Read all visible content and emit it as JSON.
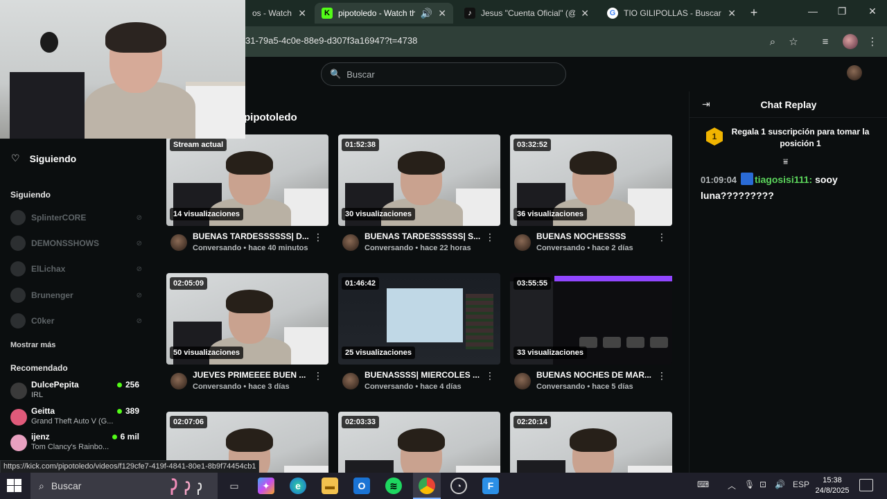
{
  "tabs": [
    {
      "title": "os - Watch C",
      "fav_color": "#53fc18",
      "fav_glyph": ""
    },
    {
      "title": "pipotoledo - Watch the",
      "fav_color": "#53fc18",
      "fav_glyph": "K"
    },
    {
      "title": "Jesus \"Cuenta Oficial\" (@jes",
      "fav_color": "#111111",
      "fav_glyph": "♪"
    },
    {
      "title": "TIO GILIPOLLAS - Buscar con",
      "fav_color": "#ffffff",
      "fav_glyph": "G"
    }
  ],
  "address": {
    "url": "31-79a5-4c0e-88e9-d307f3a16947?t=4738"
  },
  "search": {
    "placeholder": "Buscar"
  },
  "sidebar": {
    "following_label": "Siguiendo",
    "section_following": "Siguiendo",
    "followed": [
      {
        "name": "SplinterCORE"
      },
      {
        "name": "DEMONSSHOWS"
      },
      {
        "name": "ElLichax"
      },
      {
        "name": "Brunenger"
      },
      {
        "name": "C0ker"
      }
    ],
    "show_more": "Mostrar más",
    "section_recommended": "Recomendado",
    "recommended": [
      {
        "name": "DulcePepita",
        "category": "IRL",
        "viewers": "256"
      },
      {
        "name": "Geitta",
        "category": "Grand Theft Auto V (G...",
        "viewers": "389"
      },
      {
        "name": "ijenz",
        "category": "Tom Clancy's Rainbo...",
        "viewers": "6 mil"
      }
    ]
  },
  "channel": {
    "name": "pipotoledo"
  },
  "videos": [
    {
      "duration": "Stream actual",
      "views": "14 visualizaciones",
      "title": "BUENAS TARDESSSSSS| D...",
      "sub": "Conversando • hace 40 minutos",
      "thumb": "room"
    },
    {
      "duration": "01:52:38",
      "views": "30 visualizaciones",
      "title": "BUENAS TARDESSSSSS| S...",
      "sub": "Conversando • hace 22 horas",
      "thumb": "room"
    },
    {
      "duration": "03:32:52",
      "views": "36 visualizaciones",
      "title": "BUENAS NOCHESSSS",
      "sub": "Conversando • hace 2 días",
      "thumb": "room"
    },
    {
      "duration": "02:05:09",
      "views": "50 visualizaciones",
      "title": "JUEVES PRIMEEEE BUEN ...",
      "sub": "Conversando • hace 3 días",
      "thumb": "room"
    },
    {
      "duration": "01:46:42",
      "views": "25 visualizaciones",
      "title": "BUENASSSS| MIERCOLES ...",
      "sub": "Conversando • hace 4 días",
      "thumb": "screen"
    },
    {
      "duration": "03:55:55",
      "views": "33 visualizaciones",
      "title": "BUENAS NOCHES DE MAR...",
      "sub": "Conversando • hace 5 días",
      "thumb": "discord"
    },
    {
      "duration": "02:07:06",
      "views": "",
      "title": "",
      "sub": "",
      "thumb": "room"
    },
    {
      "duration": "02:03:33",
      "views": "",
      "title": "",
      "sub": "",
      "thumb": "room"
    },
    {
      "duration": "02:20:14",
      "views": "",
      "title": "",
      "sub": "",
      "thumb": "room"
    }
  ],
  "chat": {
    "title": "Chat Replay",
    "pinned_rank": "1",
    "pinned_text": "Regala 1 suscripción para tomar la posición 1",
    "messages": [
      {
        "time": "01:09:04",
        "user": "tiagosisi111",
        "text": "sooy luna?????????"
      }
    ]
  },
  "status_url": "https://kick.com/pipotoledo/videos/f129cfe7-419f-4841-80e1-8b9f74454cb1",
  "taskbar": {
    "search_placeholder": "Buscar",
    "language": "ESP",
    "time": "15:38",
    "date": "24/8/2025"
  },
  "colors": {
    "accent": "#53fc18",
    "chat_user": "#5cd65c",
    "rank_badge": "#f0b400"
  }
}
